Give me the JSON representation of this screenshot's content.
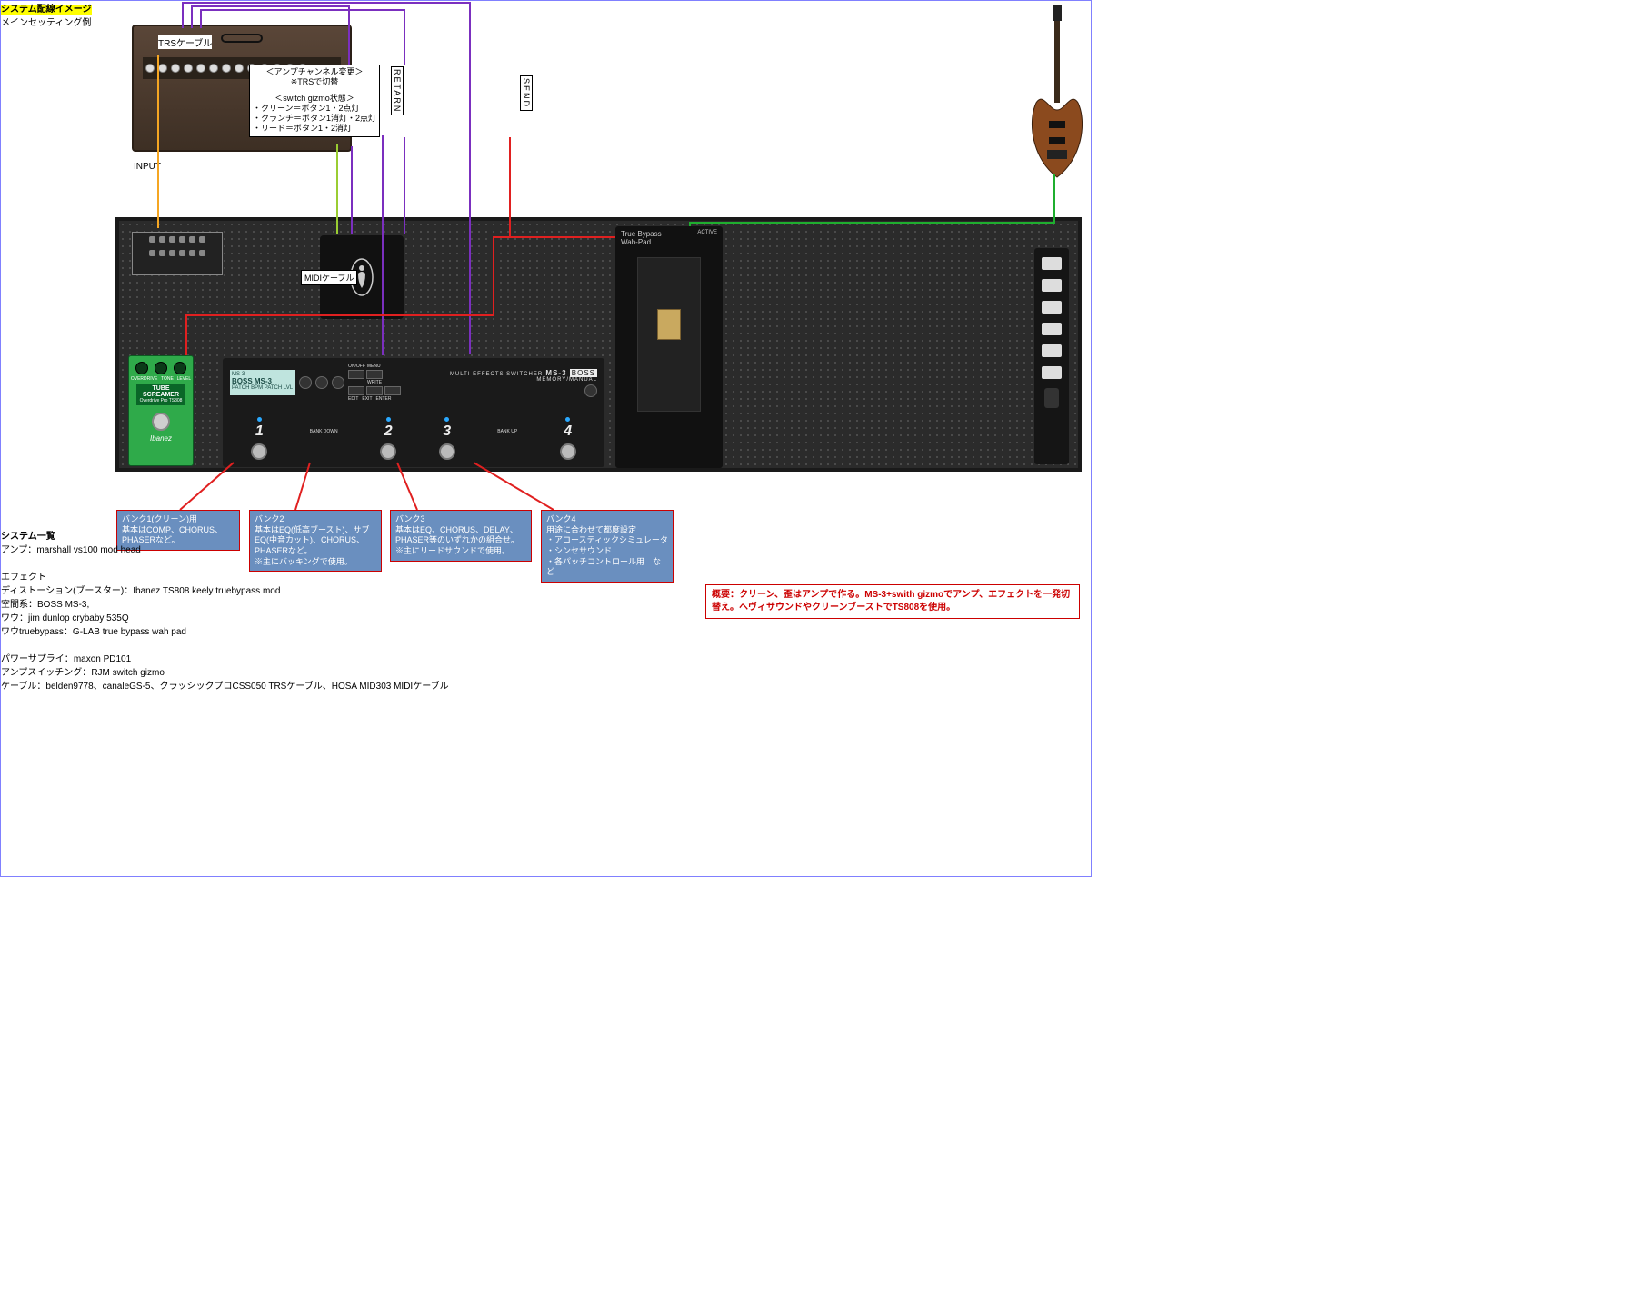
{
  "page": {
    "title": "システム配線イメージ",
    "subtitle": "メインセッティング例"
  },
  "labels": {
    "trs_cable": "TRSケーブル",
    "input": "INPUT",
    "return": "RETARN",
    "send": "SEND",
    "midi_cable": "MIDIケーブル"
  },
  "amp_channel_box": {
    "line1": "＜アンプチャンネル変更＞",
    "line2": "※TRSで切替",
    "sw_title": "＜switch gizmo状態＞",
    "clean": "・クリーン＝ボタン1・2点灯",
    "crunch": "・クランチ＝ボタン1消灯・2点灯",
    "lead": "・リード＝ボタン1・2消灯"
  },
  "ts808": {
    "name": "TUBE SCREAMER",
    "sub": "Overdrive Pro   TS808",
    "brand": "Ibanez"
  },
  "ms3": {
    "display_l1": "MS-3",
    "display_l2": "BOSS MS-3",
    "display_l3": "PATCH   BPM   PATCH LVL",
    "title": "MULTI EFFECTS SWITCHER",
    "model": "MS-3",
    "brand": "BOSS",
    "memory": "MEMORY/MANUAL",
    "buttons": {
      "onoff": "ON/OFF",
      "menu": "MENU",
      "write": "WRITE",
      "edit": "EDIT",
      "exit": "EXIT",
      "enter": "ENTER"
    },
    "feet": {
      "1": "1",
      "2": "2",
      "3": "3",
      "4": "4"
    },
    "bank_down": "BANK DOWN",
    "bank_up": "BANK UP"
  },
  "wah": {
    "title": "True Bypass",
    "title2": "Wah-Pad",
    "active": "ACTIVE"
  },
  "banks": {
    "b1_title": "バンク1(クリーン)用",
    "b1_body": "基本はCOMP、CHORUS、PHASERなど。",
    "b2_title": "バンク2",
    "b2_body1": "基本はEQ(低高ブースト)、サブEQ(中音カット)、CHORUS、PHASERなど。",
    "b2_body2": "※主にバッキングで使用。",
    "b3_title": "バンク3",
    "b3_body1": "基本はEQ、CHORUS、DELAY、PHASER等のいずれかの組合せ。",
    "b3_body2": "※主にリードサウンドで使用。",
    "b4_title": "バンク4",
    "b4_l1": "用途に合わせて都度設定",
    "b4_l2": "・アコースティックシミュレータ",
    "b4_l3": "・シンセサウンド",
    "b4_l4": "・各パッチコントロール用　など"
  },
  "summary": {
    "label": "概要：",
    "text": "クリーン、歪はアンプで作る。MS-3+swith gizmoでアンプ、エフェクトを一発切替え。ヘヴィサウンドやクリーンブーストでTS808を使用。"
  },
  "system_list": {
    "heading": "システム一覧",
    "amp_label": "アンプ：",
    "amp": "marshall vs100 mod head",
    "fx_heading": "エフェクト",
    "dist_label": "ディストーション(ブースター)：",
    "dist": "Ibanez TS808 keely truebypass mod",
    "spatial_label": "空間系：",
    "spatial": "BOSS MS-3,",
    "wah_label": "ワウ：",
    "wah": "jim dunlop crybaby 535Q",
    "wah_tb_label": "ワウtruebypass：",
    "wah_tb": "G-LAB true bypass wah pad",
    "psu_label": "パワーサプライ：",
    "psu": "maxon PD101",
    "ampsw_label": "アンプスイッチング：",
    "ampsw": "RJM switch gizmo",
    "cable_label": "ケーブル：",
    "cable": "belden9778、canaleGS-5、クラッシックプロCSS050 TRSケーブル、HOSA MID303 MIDIケーブル"
  }
}
